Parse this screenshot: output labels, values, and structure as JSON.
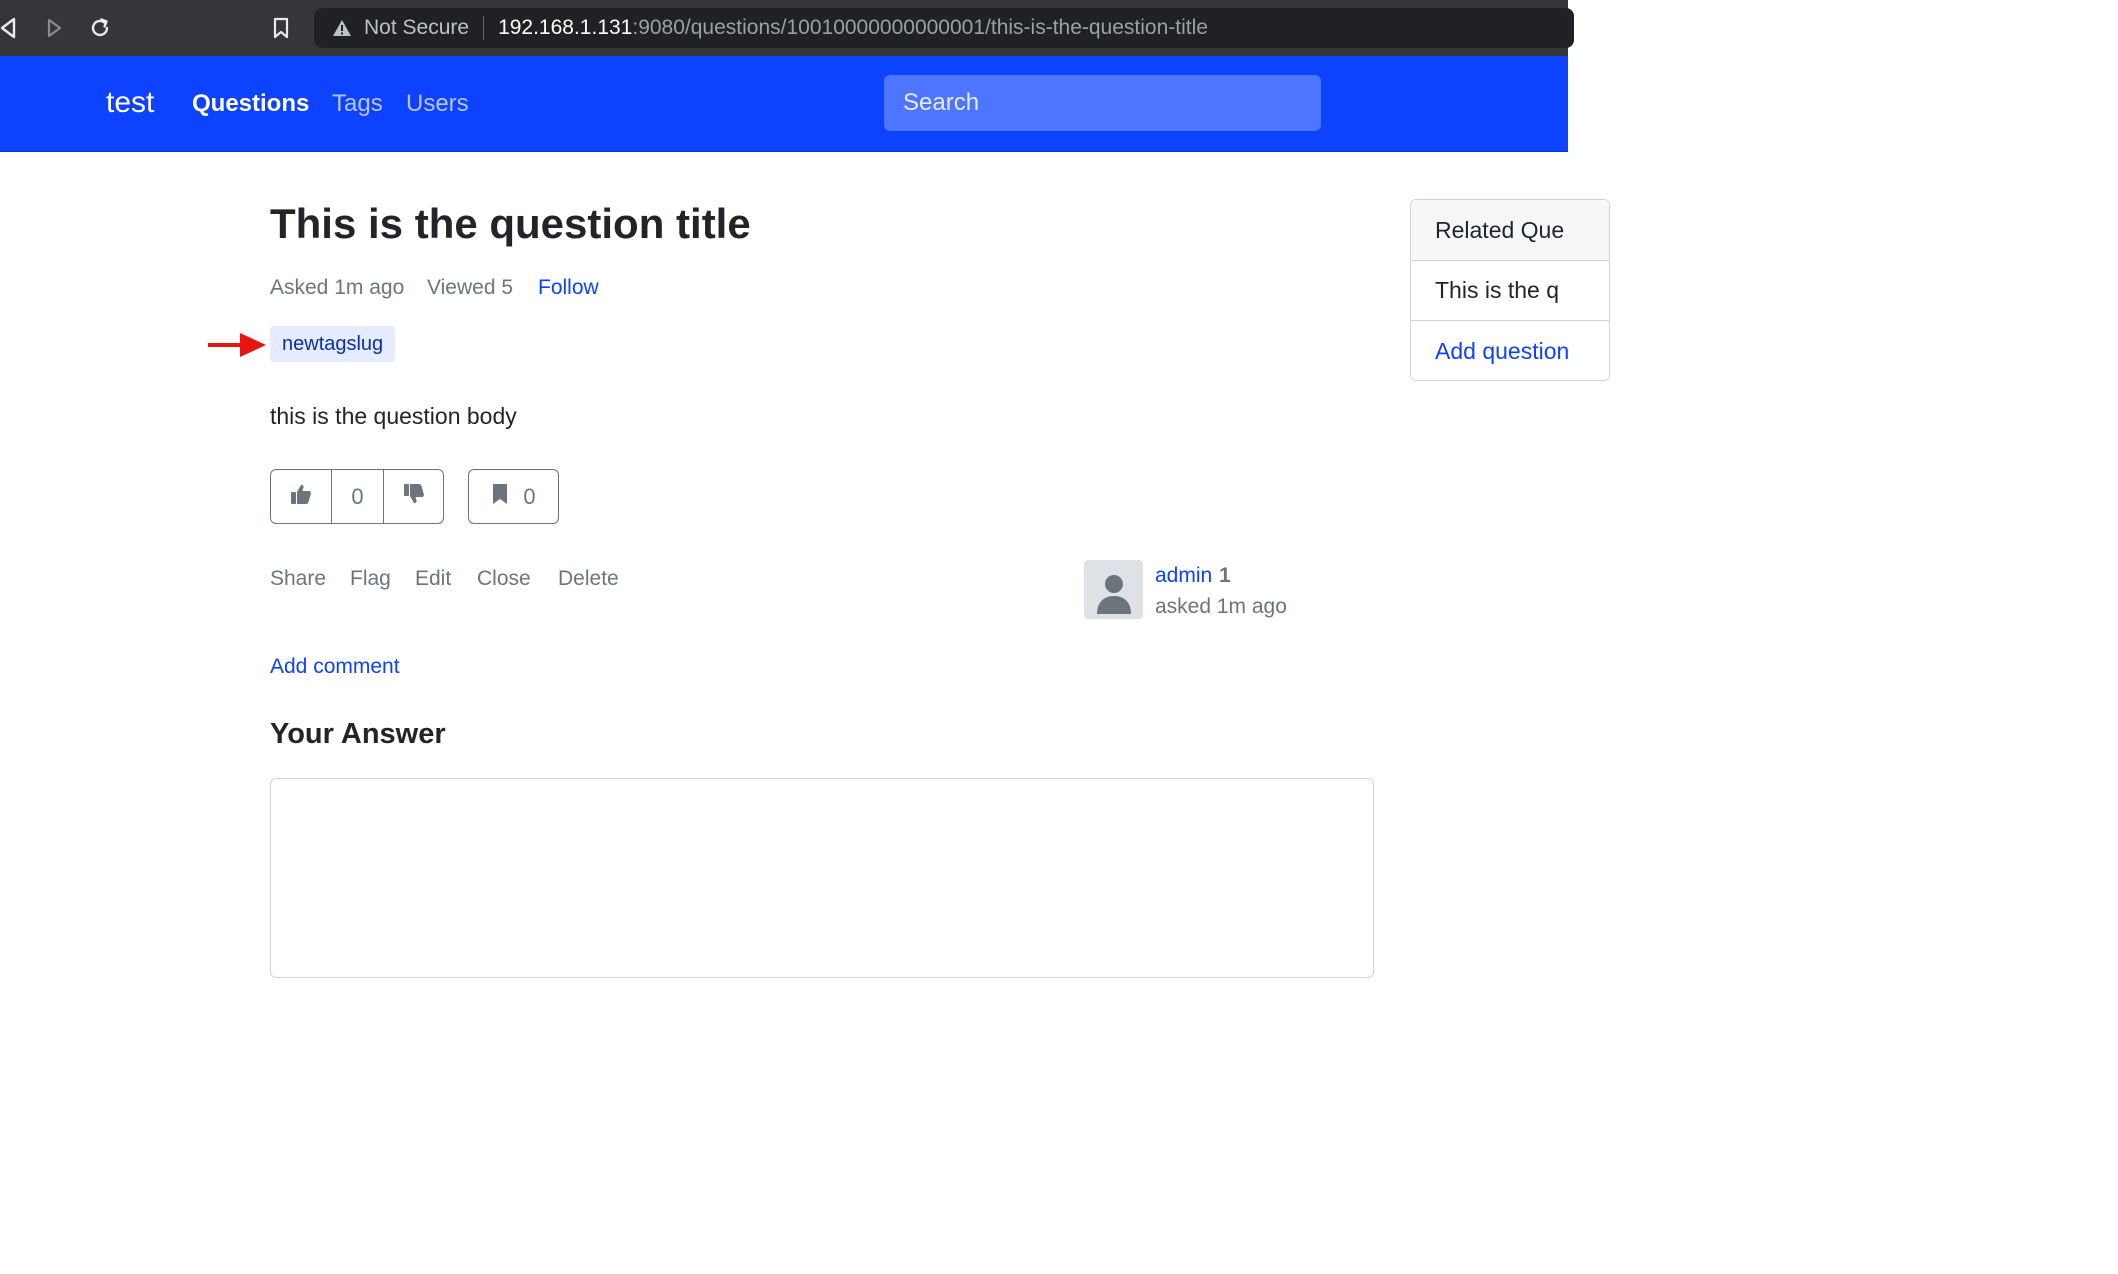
{
  "browser": {
    "security_label": "Not Secure",
    "url_host": "192.168.1.131",
    "url_path": ":9080/questions/10010000000000001/this-is-the-question-title"
  },
  "navbar": {
    "brand": "test",
    "links": [
      "Questions",
      "Tags",
      "Users"
    ],
    "active_link": "Questions",
    "search_placeholder": "Search",
    "color": "#0d42ff"
  },
  "question": {
    "title": "This is the question title",
    "asked": "Asked 1m ago",
    "viewed": "Viewed 5",
    "follow": "Follow",
    "tag": "newtagslug",
    "body": "this is the question body",
    "vote_count": "0",
    "bookmark_count": "0",
    "actions": [
      "Share",
      "Flag",
      "Edit",
      "Close",
      "Delete"
    ],
    "author": {
      "name": "admin",
      "reputation": "1",
      "asked": "asked 1m ago"
    },
    "add_comment": "Add comment"
  },
  "answer": {
    "heading": "Your Answer"
  },
  "sidebar": {
    "heading": "Related Que",
    "item": "This is the q",
    "add_link": "Add question"
  },
  "annotation": {
    "arrow_color": "#e8140f"
  },
  "icons": [
    "back-icon",
    "forward-icon",
    "reload-icon",
    "bookmark-icon",
    "warning-icon",
    "thumbs-up-icon",
    "thumbs-down-icon",
    "user-icon"
  ]
}
